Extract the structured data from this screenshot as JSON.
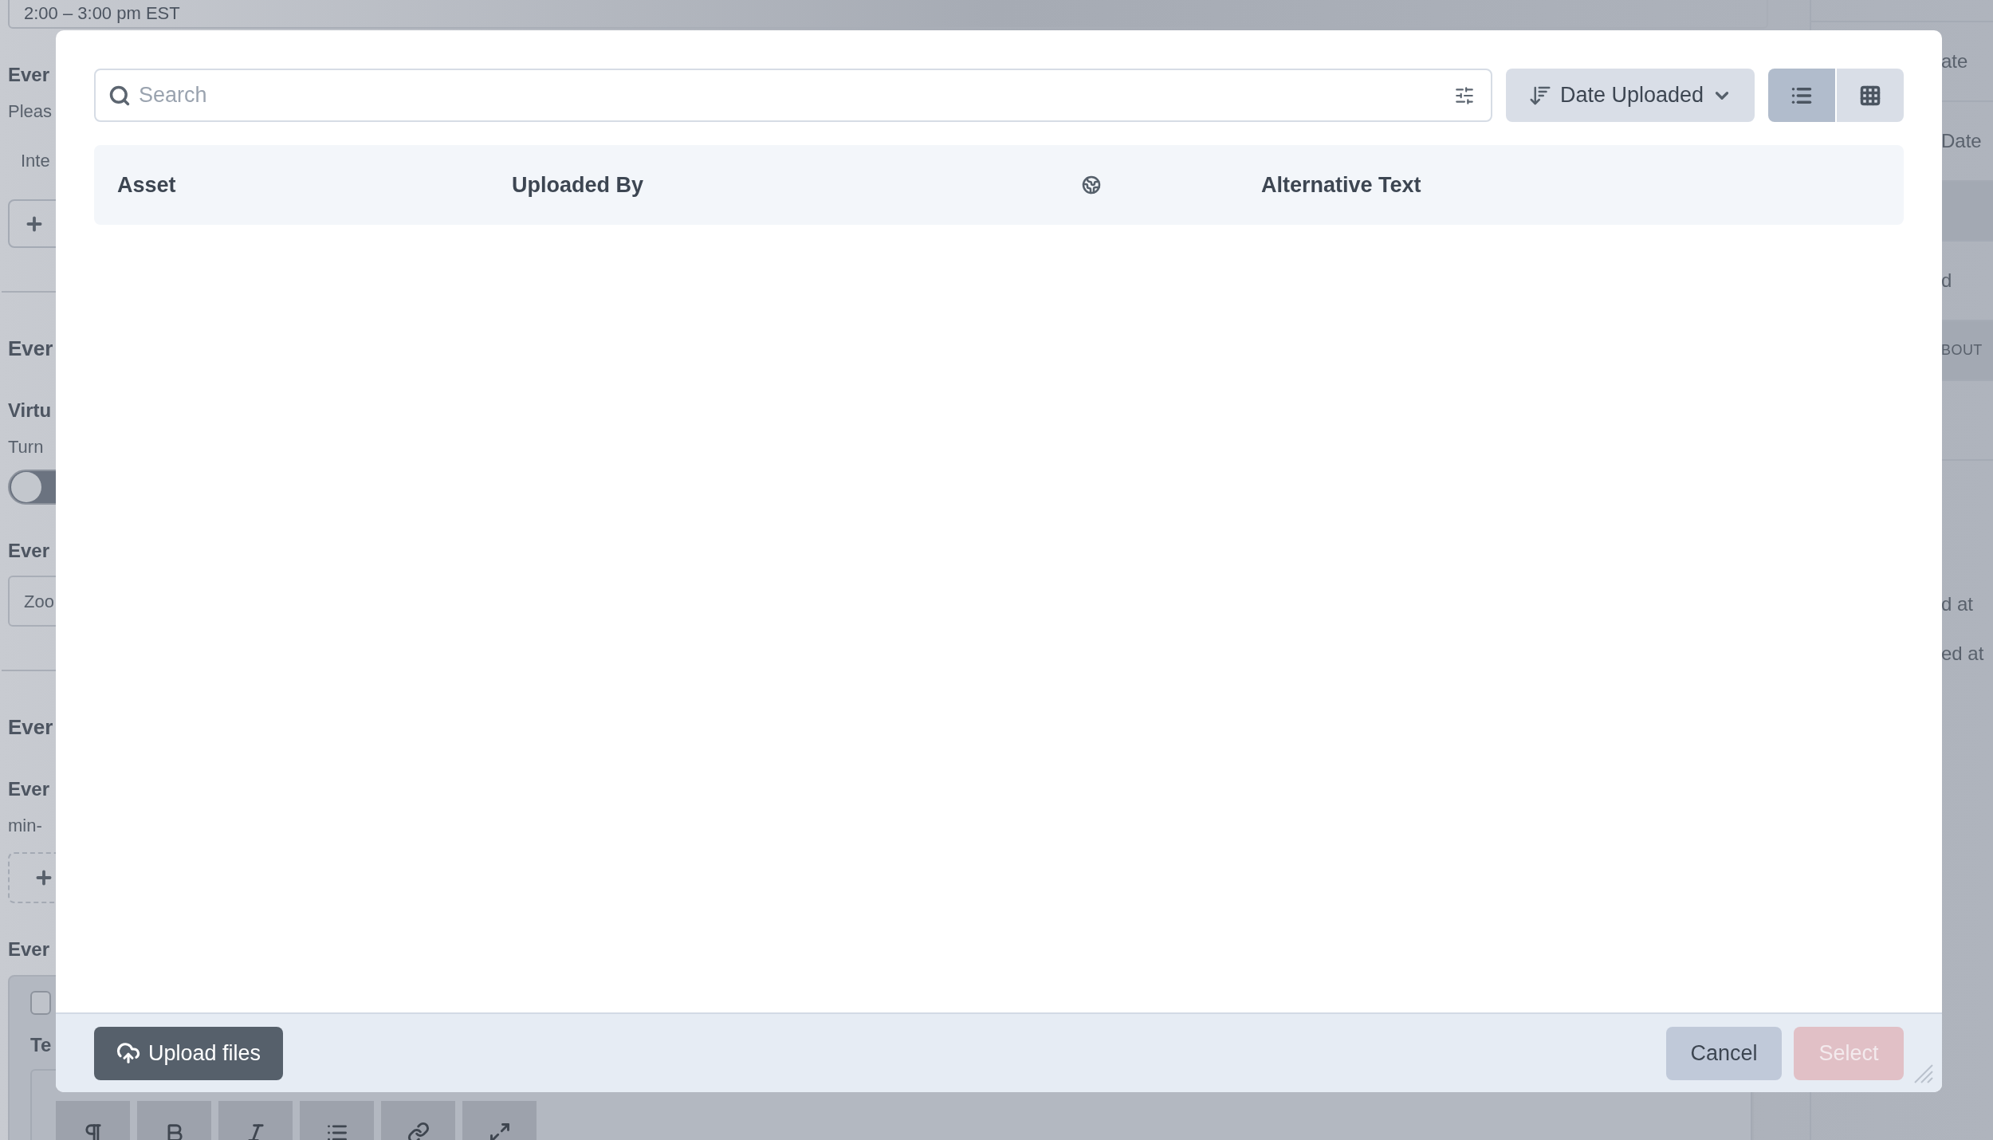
{
  "background": {
    "time_field": "2:00 – 3:00 pm EST",
    "left": [
      {
        "kind": "label",
        "text": "Ever"
      },
      {
        "kind": "text",
        "text": "Pleas"
      },
      {
        "kind": "subtext",
        "text": "Inte"
      },
      {
        "kind": "add"
      },
      {
        "kind": "divider"
      },
      {
        "kind": "heading",
        "text": "Ever"
      },
      {
        "kind": "label",
        "text": "Virtu"
      },
      {
        "kind": "text",
        "text": "Turn"
      },
      {
        "kind": "toggle",
        "on": false
      },
      {
        "kind": "label",
        "text": "Ever"
      },
      {
        "kind": "field",
        "text": "Zoo"
      },
      {
        "kind": "divider"
      },
      {
        "kind": "heading",
        "text": "Ever"
      },
      {
        "kind": "label",
        "text": "Ever"
      },
      {
        "kind": "text",
        "text": "min-"
      },
      {
        "kind": "dashed_add"
      },
      {
        "kind": "label",
        "text": "Ever"
      },
      {
        "kind": "panel",
        "checked": false,
        "text": "Te"
      }
    ],
    "right": [
      {
        "kind": "row",
        "text": "ate"
      },
      {
        "kind": "row",
        "text": "Date"
      },
      {
        "kind": "band"
      },
      {
        "kind": "row",
        "text": "d"
      },
      {
        "kind": "band",
        "text": "BOUT"
      },
      {
        "kind": "row"
      }
    ],
    "right_lines": [
      "d at",
      "ed at"
    ]
  },
  "modal": {
    "search": {
      "placeholder": "Search"
    },
    "sort": {
      "label": "Date Uploaded"
    },
    "views": [
      {
        "kind": "list",
        "selected": true
      },
      {
        "kind": "grid",
        "selected": false
      }
    ],
    "columns": [
      {
        "kind": "text",
        "label": "Asset"
      },
      {
        "kind": "text",
        "label": "Uploaded By"
      },
      {
        "kind": "globe"
      },
      {
        "kind": "text",
        "label": "Alternative Text"
      }
    ],
    "upload_button": "Upload files",
    "cancel_button": "Cancel",
    "select_button": {
      "label": "Select",
      "disabled": true
    }
  }
}
